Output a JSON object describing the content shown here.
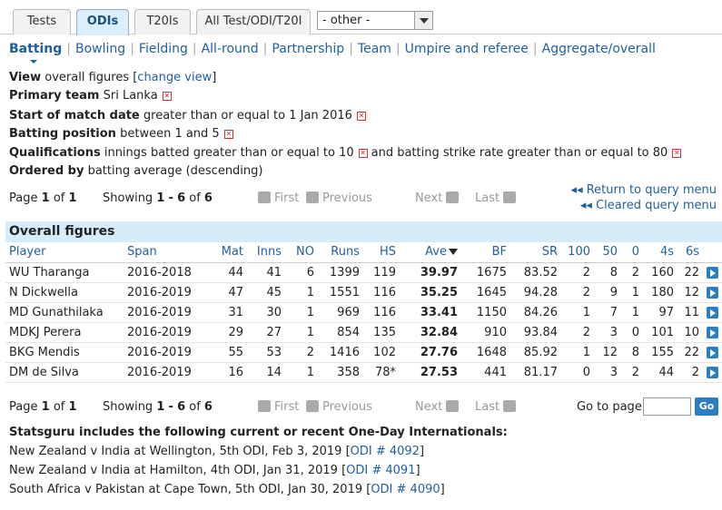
{
  "tabs": [
    {
      "label": "Tests"
    },
    {
      "label": "ODIs"
    },
    {
      "label": "T20Is"
    },
    {
      "label": "All Test/ODI/T20I"
    }
  ],
  "other_select": {
    "value": "- other -"
  },
  "nav": {
    "items": [
      "Batting",
      "Bowling",
      "Fielding",
      "All-round",
      "Partnership",
      "Team",
      "Umpire and referee",
      "Aggregate/overall"
    ],
    "active": "Batting"
  },
  "query": {
    "view_label": "View",
    "view_value": "overall figures [",
    "view_link": "change view",
    "view_end": "]",
    "team_label": "Primary team",
    "team_value": "Sri Lanka",
    "date_label": "Start of match date",
    "date_value": "greater than or equal to 1 Jan 2016",
    "pos_label": "Batting position",
    "pos_value": "between 1 and 5",
    "qual_label": "Qualifications",
    "qual_value1": "innings batted greater than or equal to 10",
    "qual_value2": "and batting strike rate greater than or equal to 80",
    "order_label": "Ordered by",
    "order_value": "batting average (descending)"
  },
  "paging": {
    "page_prefix": "Page",
    "page_num": "1",
    "page_of": "of",
    "page_total": "1",
    "showing_prefix": "Showing",
    "showing_from": "1",
    "showing_dash": "-",
    "showing_to": "6",
    "showing_of": "of",
    "showing_total": "6",
    "first": "First",
    "previous": "Previous",
    "next": "Next",
    "last": "Last",
    "return_link": "Return to query menu",
    "cleared_link": "Cleared query menu",
    "goto_label": "Go to page",
    "go_btn": "Go"
  },
  "table": {
    "title": "Overall figures",
    "columns": [
      "Player",
      "Span",
      "Mat",
      "Inns",
      "NO",
      "Runs",
      "HS",
      "Ave",
      "BF",
      "SR",
      "100",
      "50",
      "0",
      "4s",
      "6s"
    ],
    "rows": [
      [
        "WU Tharanga",
        "2016-2018",
        "44",
        "41",
        "6",
        "1399",
        "119",
        "39.97",
        "1675",
        "83.52",
        "2",
        "8",
        "2",
        "160",
        "22"
      ],
      [
        "N Dickwella",
        "2016-2019",
        "47",
        "45",
        "1",
        "1551",
        "116",
        "35.25",
        "1645",
        "94.28",
        "2",
        "9",
        "1",
        "180",
        "12"
      ],
      [
        "MD Gunathilaka",
        "2016-2019",
        "31",
        "30",
        "1",
        "969",
        "116",
        "33.41",
        "1150",
        "84.26",
        "1",
        "7",
        "1",
        "97",
        "11"
      ],
      [
        "MDKJ Perera",
        "2016-2019",
        "29",
        "27",
        "1",
        "854",
        "135",
        "32.84",
        "910",
        "93.84",
        "2",
        "3",
        "0",
        "101",
        "10"
      ],
      [
        "BKG Mendis",
        "2016-2019",
        "55",
        "53",
        "2",
        "1416",
        "102",
        "27.76",
        "1648",
        "85.92",
        "1",
        "12",
        "8",
        "155",
        "22"
      ],
      [
        "DM de Silva",
        "2016-2019",
        "16",
        "14",
        "1",
        "358",
        "78*",
        "27.53",
        "441",
        "81.17",
        "0",
        "3",
        "2",
        "44",
        "2"
      ]
    ]
  },
  "footer": {
    "heading": "Statsguru includes the following current or recent One-Day Internationals:",
    "matches": [
      {
        "text": "New Zealand v India at Wellington, 5th ODI, Feb 3, 2019 [",
        "link": "ODI # 4092",
        "end": "]"
      },
      {
        "text": "New Zealand v India at Hamilton, 4th ODI, Jan 31, 2019 [",
        "link": "ODI # 4091",
        "end": "]"
      },
      {
        "text": "South Africa v Pakistan at Cape Town, 5th ODI, Jan 30, 2019 [",
        "link": "ODI # 4090",
        "end": "]"
      }
    ]
  }
}
